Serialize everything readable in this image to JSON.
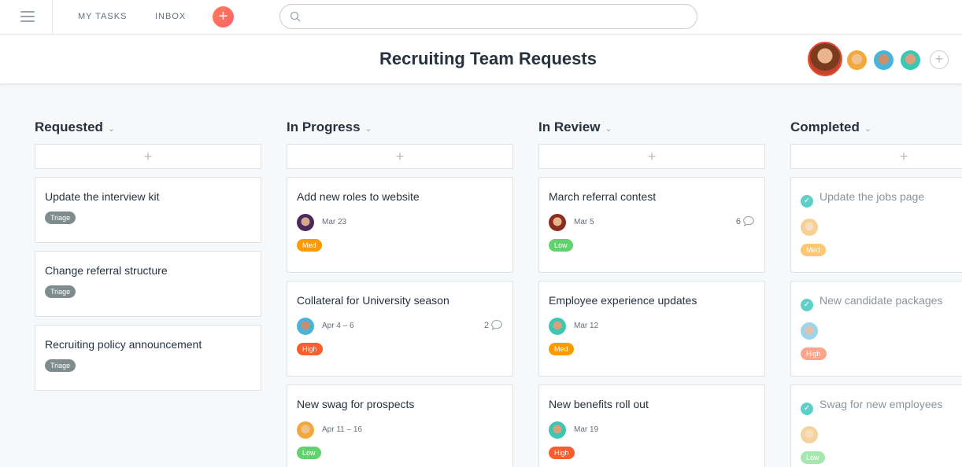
{
  "nav": {
    "my_tasks": "MY TASKS",
    "inbox": "INBOX",
    "add": "+",
    "search_placeholder": ""
  },
  "project": {
    "title": "Recruiting Team Requests",
    "add_member": "+"
  },
  "columns": [
    {
      "title": "Requested",
      "add": "+",
      "cards": [
        {
          "title": "Update the interview kit",
          "tag": "Triage"
        },
        {
          "title": "Change referral structure",
          "tag": "Triage"
        },
        {
          "title": "Recruiting policy announcement",
          "tag": "Triage"
        }
      ]
    },
    {
      "title": "In Progress",
      "add": "+",
      "cards": [
        {
          "title": "Add new roles to website",
          "date": "Mar 23",
          "comments": "",
          "tag": "Med"
        },
        {
          "title": "Collateral for University season",
          "date": "Apr 4 – 6",
          "comments": "2",
          "tag": "High"
        },
        {
          "title": "New swag for prospects",
          "date": "Apr 11 – 16",
          "comments": "",
          "tag": "Low"
        }
      ]
    },
    {
      "title": "In Review",
      "add": "+",
      "cards": [
        {
          "title": "March referral contest",
          "date": "Mar 5",
          "comments": "6",
          "tag": "Low"
        },
        {
          "title": "Employee experience updates",
          "date": "Mar 12",
          "comments": "",
          "tag": "Med"
        },
        {
          "title": "New benefits roll out",
          "date": "Mar 19",
          "comments": "",
          "tag": "High"
        }
      ]
    },
    {
      "title": "Completed",
      "add": "+",
      "cards": [
        {
          "title": "Update the jobs page",
          "tag": "Med"
        },
        {
          "title": "New candidate packages",
          "tag": "High"
        },
        {
          "title": "Swag for new employees",
          "tag": "Low"
        }
      ]
    }
  ],
  "colors": {
    "triage": "#7f8c8d",
    "med": "#fd9a00",
    "high": "#fc5d2e",
    "low": "#62d26f",
    "check": "#5fd0c7"
  },
  "icons": [
    "hamburger-icon",
    "search-icon",
    "plus-icon",
    "chevron-down-icon",
    "comment-icon",
    "check-icon",
    "avatar"
  ]
}
